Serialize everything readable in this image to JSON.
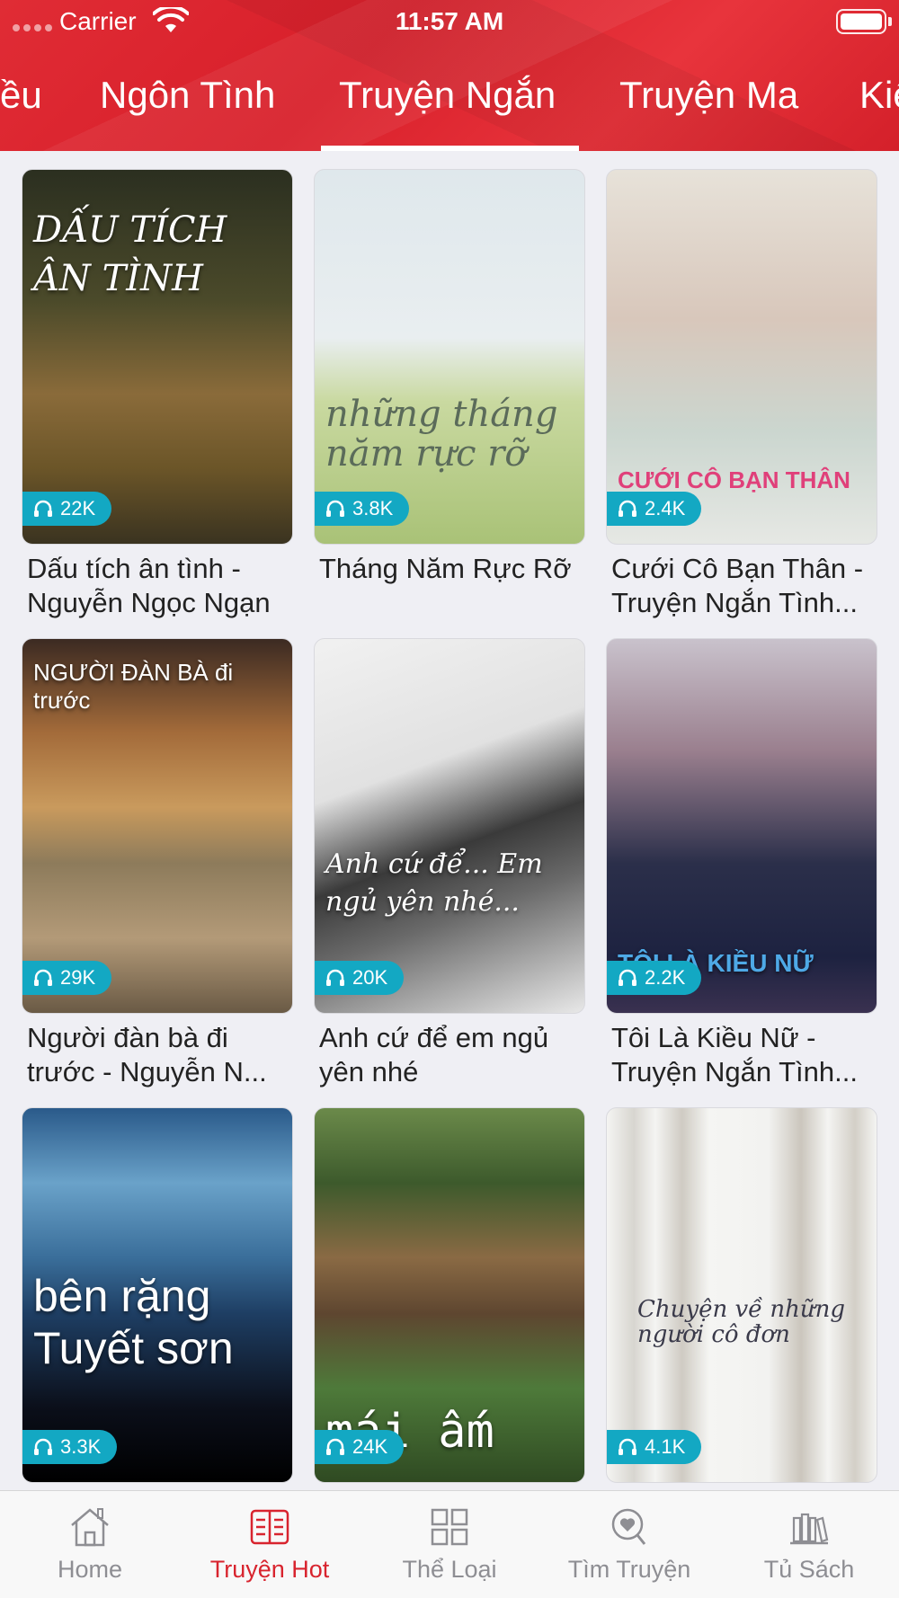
{
  "status_bar": {
    "carrier": "Carrier",
    "time": "11:57 AM"
  },
  "tabs": [
    {
      "label": "ều"
    },
    {
      "label": "Ngôn Tình"
    },
    {
      "label": "Truyện Ngắn"
    },
    {
      "label": "Truyện Ma"
    },
    {
      "label": "Kiế"
    }
  ],
  "active_tab": "Truyện Ngắn",
  "books": [
    {
      "title": "Dấu tích ân tình - Nguyễn Ngọc Ngạn",
      "listens": "22K",
      "cover_text": "DẤU TÍCH ÂN TÌNH"
    },
    {
      "title": "Tháng Năm Rực Rỡ",
      "listens": "3.8K",
      "cover_text": "những tháng năm rực rỡ"
    },
    {
      "title": "Cưới Cô Bạn Thân - Truyện Ngắn Tình...",
      "listens": "2.4K",
      "cover_text": "CƯỚI CÔ BẠN THÂN"
    },
    {
      "title": "Người đàn bà đi trước - Nguyễn N...",
      "listens": "29K",
      "cover_text": "NGƯỜI ĐÀN BÀ đi trước"
    },
    {
      "title": "Anh cứ để em ngủ yên nhé",
      "listens": "20K",
      "cover_text": "Anh cứ để... Em ngủ yên nhé..."
    },
    {
      "title": "Tôi Là Kiều Nữ - Truyện Ngắn Tình...",
      "listens": "2.2K",
      "cover_text": "TÔI LÀ KIỀU NỮ"
    },
    {
      "title": "",
      "listens": "3.3K",
      "cover_text": "bên rặng Tuyết sơn"
    },
    {
      "title": "",
      "listens": "24K",
      "cover_text": "mái ấm"
    },
    {
      "title": "",
      "listens": "4.1K",
      "cover_text": "Chuyện về những người cô đơn"
    }
  ],
  "tabbar": {
    "home": "Home",
    "hot": "Truyện Hot",
    "categories": "Thể Loại",
    "search": "Tìm Truyện",
    "bookshelf": "Tủ Sách"
  },
  "colors": {
    "header_red": "#d8242e",
    "badge_teal": "#13a8c3",
    "active_tab": "#d8242e"
  }
}
